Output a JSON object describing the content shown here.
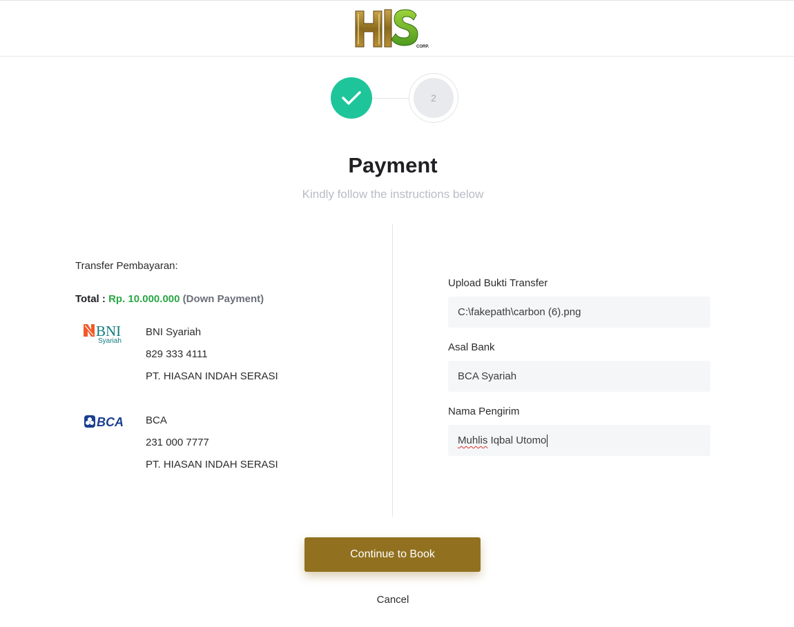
{
  "header": {
    "logo_text": "HIS",
    "logo_sub": "CORP."
  },
  "stepper": {
    "step1_icon": "check-icon",
    "step2_number": "2"
  },
  "page": {
    "title": "Payment",
    "subtitle": "Kindly follow the instructions below"
  },
  "transfer": {
    "label": "Transfer Pembayaran:",
    "total_prefix": "Total :",
    "total_amount": "Rp. 10.000.000",
    "total_note": "(Down Payment)"
  },
  "banks": [
    {
      "logo_main": "BNI",
      "logo_sub": "Syariah",
      "name": "BNI Syariah",
      "account": "829 333 4111",
      "holder": "PT. HIASAN INDAH SERASI"
    },
    {
      "logo_main": "BCA",
      "name": "BCA",
      "account": "231 000 7777",
      "holder": "PT. HIASAN INDAH SERASI"
    }
  ],
  "form": {
    "upload_label": "Upload Bukti Transfer",
    "upload_value": "C:\\fakepath\\carbon (6).png",
    "bank_label": "Asal Bank",
    "bank_value": "BCA Syariah",
    "sender_label": "Nama Pengirim",
    "sender_first": "Muhlis",
    "sender_rest": " Iqbal Utomo"
  },
  "actions": {
    "continue_label": "Continue to Book",
    "cancel_label": "Cancel"
  },
  "colors": {
    "accent_gold": "#917120",
    "success_green": "#1fc59a",
    "amount_green": "#2aa745"
  }
}
